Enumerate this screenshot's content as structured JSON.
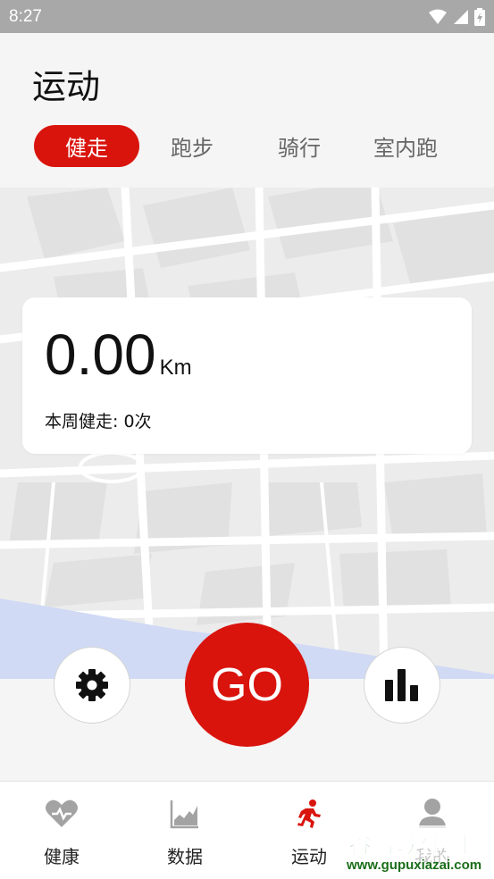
{
  "status_bar": {
    "time": "8:27"
  },
  "page": {
    "title": "运动"
  },
  "tabs": [
    {
      "label": "健走",
      "active": true
    },
    {
      "label": "跑步",
      "active": false
    },
    {
      "label": "骑行",
      "active": false
    },
    {
      "label": "室内跑",
      "active": false
    }
  ],
  "stats": {
    "distance": "0.00",
    "unit": "Km",
    "weekly_label": "本周健走: 0次"
  },
  "controls": {
    "settings_icon": "gear-icon",
    "go_label": "GO",
    "stats_icon": "bar-chart-icon"
  },
  "bottom_nav": [
    {
      "label": "健康",
      "icon": "heart-icon",
      "active": false
    },
    {
      "label": "数据",
      "icon": "area-chart-icon",
      "active": false
    },
    {
      "label": "运动",
      "icon": "running-icon",
      "active": true
    },
    {
      "label": "我的",
      "icon": "user-icon",
      "active": false
    }
  ],
  "watermark": {
    "title": "谷普软件园",
    "url": "www.gupuxiazai.com"
  },
  "colors": {
    "accent": "#d9140d",
    "status_bar": "#a8a8a8",
    "background": "#f5f5f5",
    "inactive_icon": "#999999"
  }
}
